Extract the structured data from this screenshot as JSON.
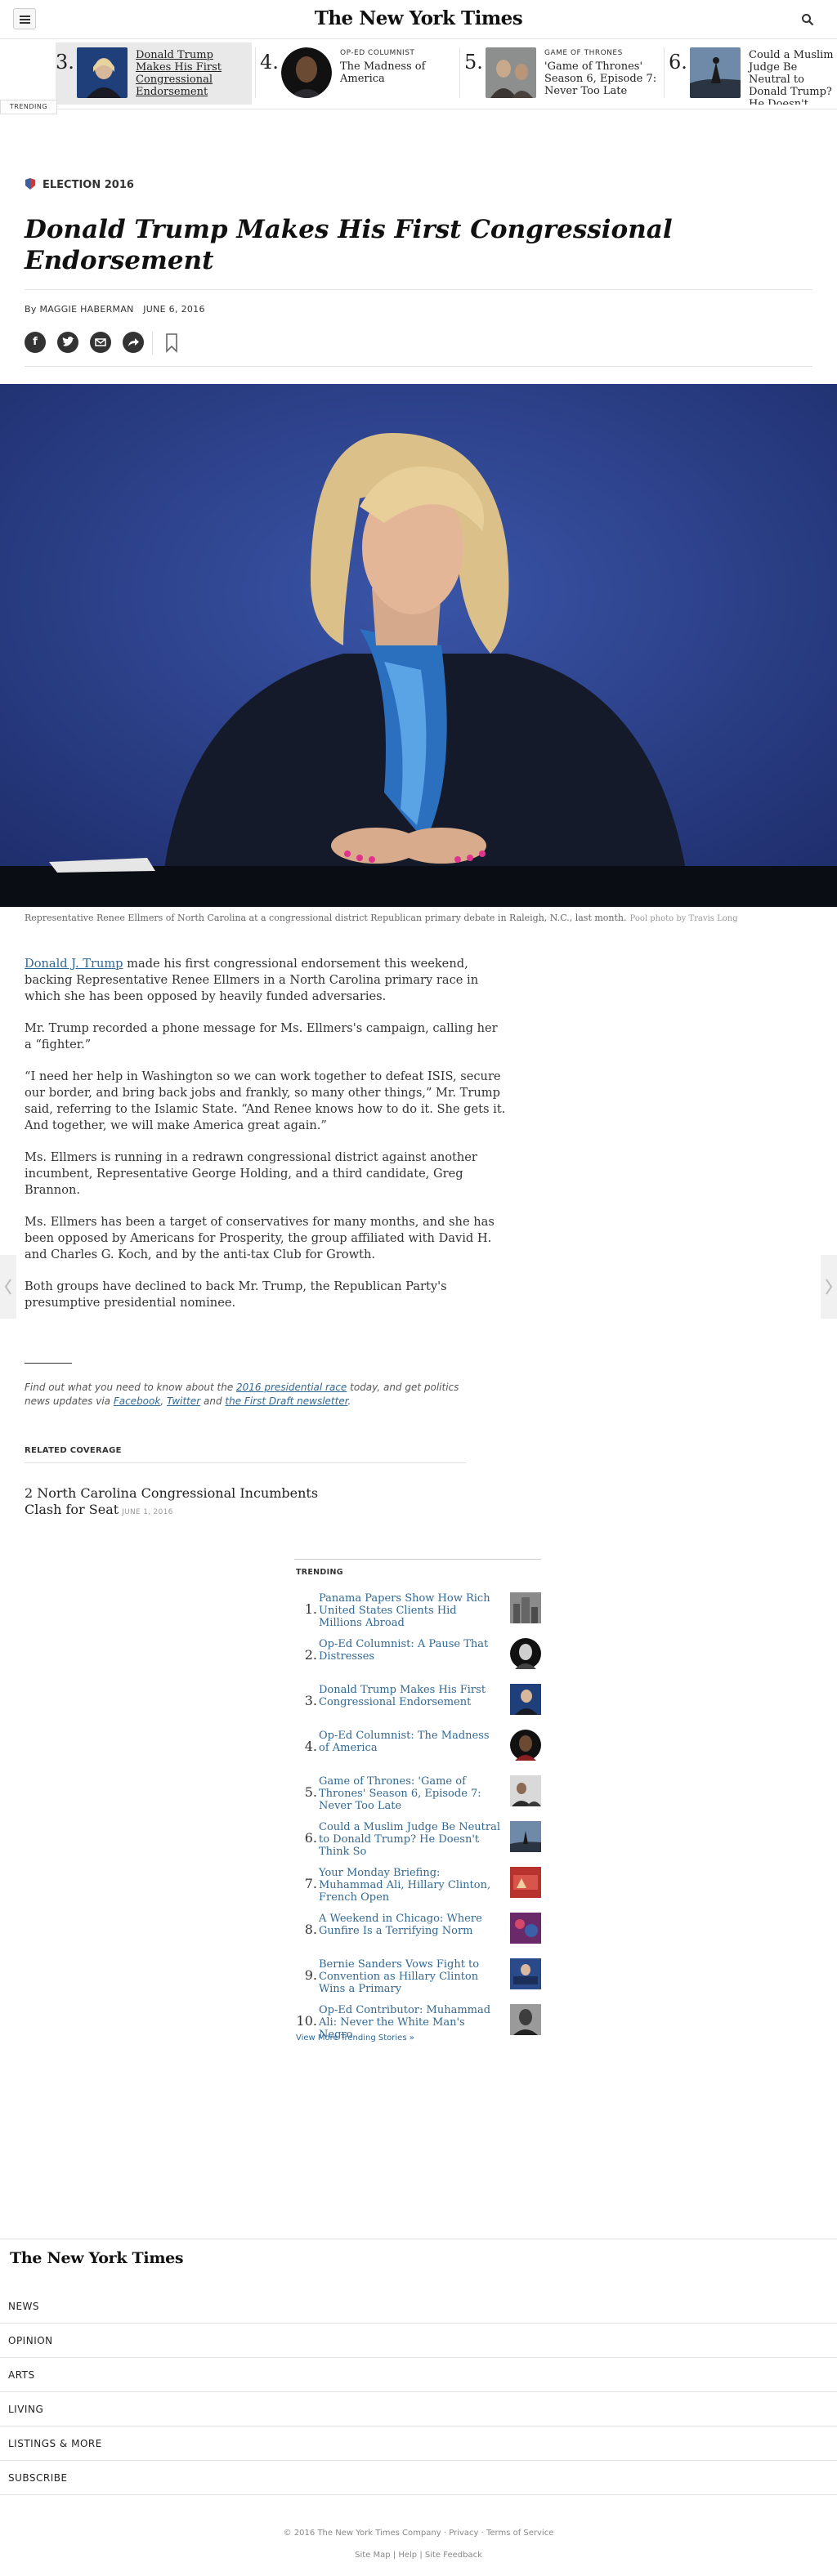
{
  "header": {
    "logo": "The New York Times",
    "trending_label": "TRENDING"
  },
  "strip": [
    {
      "num": "3.",
      "kicker": "",
      "title": "Donald Trump Makes His First Congressional Endorsement"
    },
    {
      "num": "4.",
      "kicker": "OP-ED COLUMNIST",
      "title": "The Madness of America"
    },
    {
      "num": "5.",
      "kicker": "GAME OF THRONES",
      "title": "'Game of Thrones' Season 6, Episode 7: Never Too Late"
    },
    {
      "num": "6.",
      "kicker": "",
      "title": "Could a Muslim Judge Be Neutral to Donald Trump? He Doesn't Think So"
    }
  ],
  "article": {
    "section": "ELECTION 2016",
    "headline": "Donald Trump Makes His First Congressional Endorsement",
    "author": "By MAGGIE HABERMAN",
    "date": "JUNE 6, 2016",
    "caption": "Representative Renee Ellmers of North Carolina at a congressional district Republican primary debate in Raleigh, N.C., last month.",
    "credit": "Pool photo by Travis Long",
    "link_name": "Donald J. Trump",
    "p1_rest": " made his first congressional endorsement this weekend, backing Representative Renee Ellmers in a North Carolina primary race in which she has been opposed by heavily funded adversaries.",
    "p2": "Mr. Trump recorded a phone message for Ms. Ellmers's campaign, calling her a “fighter.”",
    "p3": "“I need her help in Washington so we can work together to defeat ISIS, secure our border, and bring back jobs and frankly, so many other things,” Mr. Trump said, referring to the Islamic State. “And Renee knows how to do it. She gets it. And together, we will make America great again.”",
    "p4": "Ms. Ellmers is running in a redrawn congressional district against another incumbent, Representative George Holding, and a third candidate, Greg Brannon.",
    "p5": "Ms. Ellmers has been a target of conservatives for many months, and she has been opposed by Americans for Prosperity, the group affiliated with David H. and Charles G. Koch, and by the anti-tax Club for Growth.",
    "p6": "Both groups have declined to back Mr. Trump, the Republican Party's presumptive presidential nominee."
  },
  "promo": {
    "pre": "Find out what you need to know about the ",
    "link1": "2016 presidential race",
    "mid": " today, and get politics news updates via ",
    "link2": "Facebook",
    "sep": ", ",
    "link3": "Twitter",
    "and": " and ",
    "link4": "the First Draft newsletter",
    "end": "."
  },
  "related": {
    "title": "RELATED COVERAGE",
    "item": "2 North Carolina Congressional Incumbents Clash for Seat",
    "item_date": "JUNE 1, 2016"
  },
  "trending": {
    "title": "TRENDING",
    "more": "View More Trending Stories »",
    "items": [
      {
        "num": "1.",
        "title": "Panama Papers Show How Rich United States Clients Hid Millions Abroad"
      },
      {
        "num": "2.",
        "title": "Op-Ed Columnist: A Pause That Distresses"
      },
      {
        "num": "3.",
        "title": "Donald Trump Makes His First Congressional Endorsement"
      },
      {
        "num": "4.",
        "title": "Op-Ed Columnist: The Madness of America"
      },
      {
        "num": "5.",
        "title": "Game of Thrones: 'Game of Thrones' Season 6, Episode 7: Never Too Late"
      },
      {
        "num": "6.",
        "title": "Could a Muslim Judge Be Neutral to Donald Trump? He Doesn't Think So"
      },
      {
        "num": "7.",
        "title": "Your Monday Briefing: Muhammad Ali, Hillary Clinton, French Open"
      },
      {
        "num": "8.",
        "title": "A Weekend in Chicago: Where Gunfire Is a Terrifying Norm"
      },
      {
        "num": "9.",
        "title": "Bernie Sanders Vows Fight to Convention as Hillary Clinton Wins a Primary"
      },
      {
        "num": "10.",
        "title": "Op-Ed Contributor: Muhammad Ali: Never the White Man's Negro"
      }
    ]
  },
  "footer": {
    "logo": "The New York Times",
    "nav": [
      "NEWS",
      "OPINION",
      "ARTS",
      "LIVING",
      "LISTINGS & MORE",
      "SUBSCRIBE"
    ],
    "copyright": "© 2016 The New York Times Company",
    "privacy": "Privacy",
    "terms": "Terms of Service",
    "sitemap": "Site Map",
    "help": "Help",
    "feedback": "Site Feedback"
  },
  "colors": {
    "link": "#326891",
    "photo_bg": "#2c3f86"
  },
  "icons": [
    "menu-icon",
    "search-icon",
    "facebook-icon",
    "twitter-icon",
    "email-icon",
    "share-icon",
    "bookmark-icon",
    "chevron-left-icon",
    "chevron-right-icon"
  ]
}
